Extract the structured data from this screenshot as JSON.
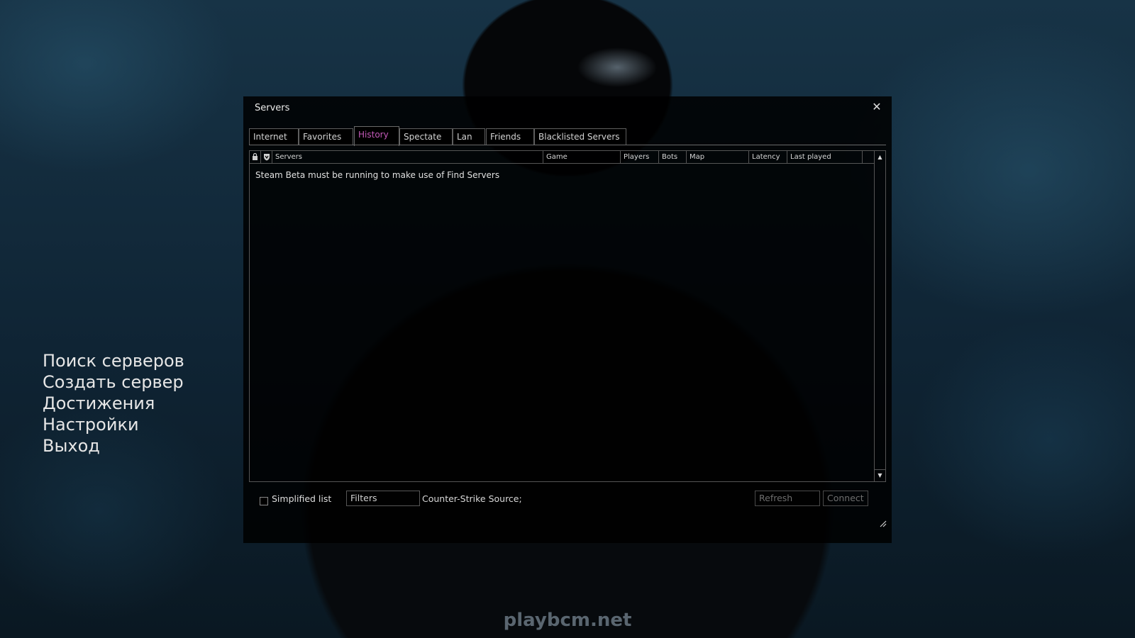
{
  "menu": {
    "items": [
      "Поиск серверов",
      "Создать сервер",
      "Достижения",
      "Настройки",
      "Выход"
    ]
  },
  "watermark": "playbcm.net",
  "window": {
    "title": "Servers",
    "close_icon": "close-icon",
    "tabs": [
      "Internet",
      "Favorites",
      "History",
      "Spectate",
      "Lan",
      "Friends",
      "Blacklisted Servers"
    ],
    "active_tab": "History",
    "columns": {
      "lock_icon": "lock-icon",
      "vac_icon": "vac-shield-icon",
      "servers": "Servers",
      "game": "Game",
      "players": "Players",
      "bots": "Bots",
      "map": "Map",
      "latency": "Latency",
      "last_played": "Last played"
    },
    "message": "Steam Beta must be running to make use of Find Servers",
    "simplified_label": "Simplified list",
    "simplified_checked": false,
    "filters_label": "Filters",
    "filter_summary": "Counter-Strike Source;",
    "refresh_label": "Refresh",
    "connect_label": "Connect",
    "accent_color": "#c45ab9"
  }
}
